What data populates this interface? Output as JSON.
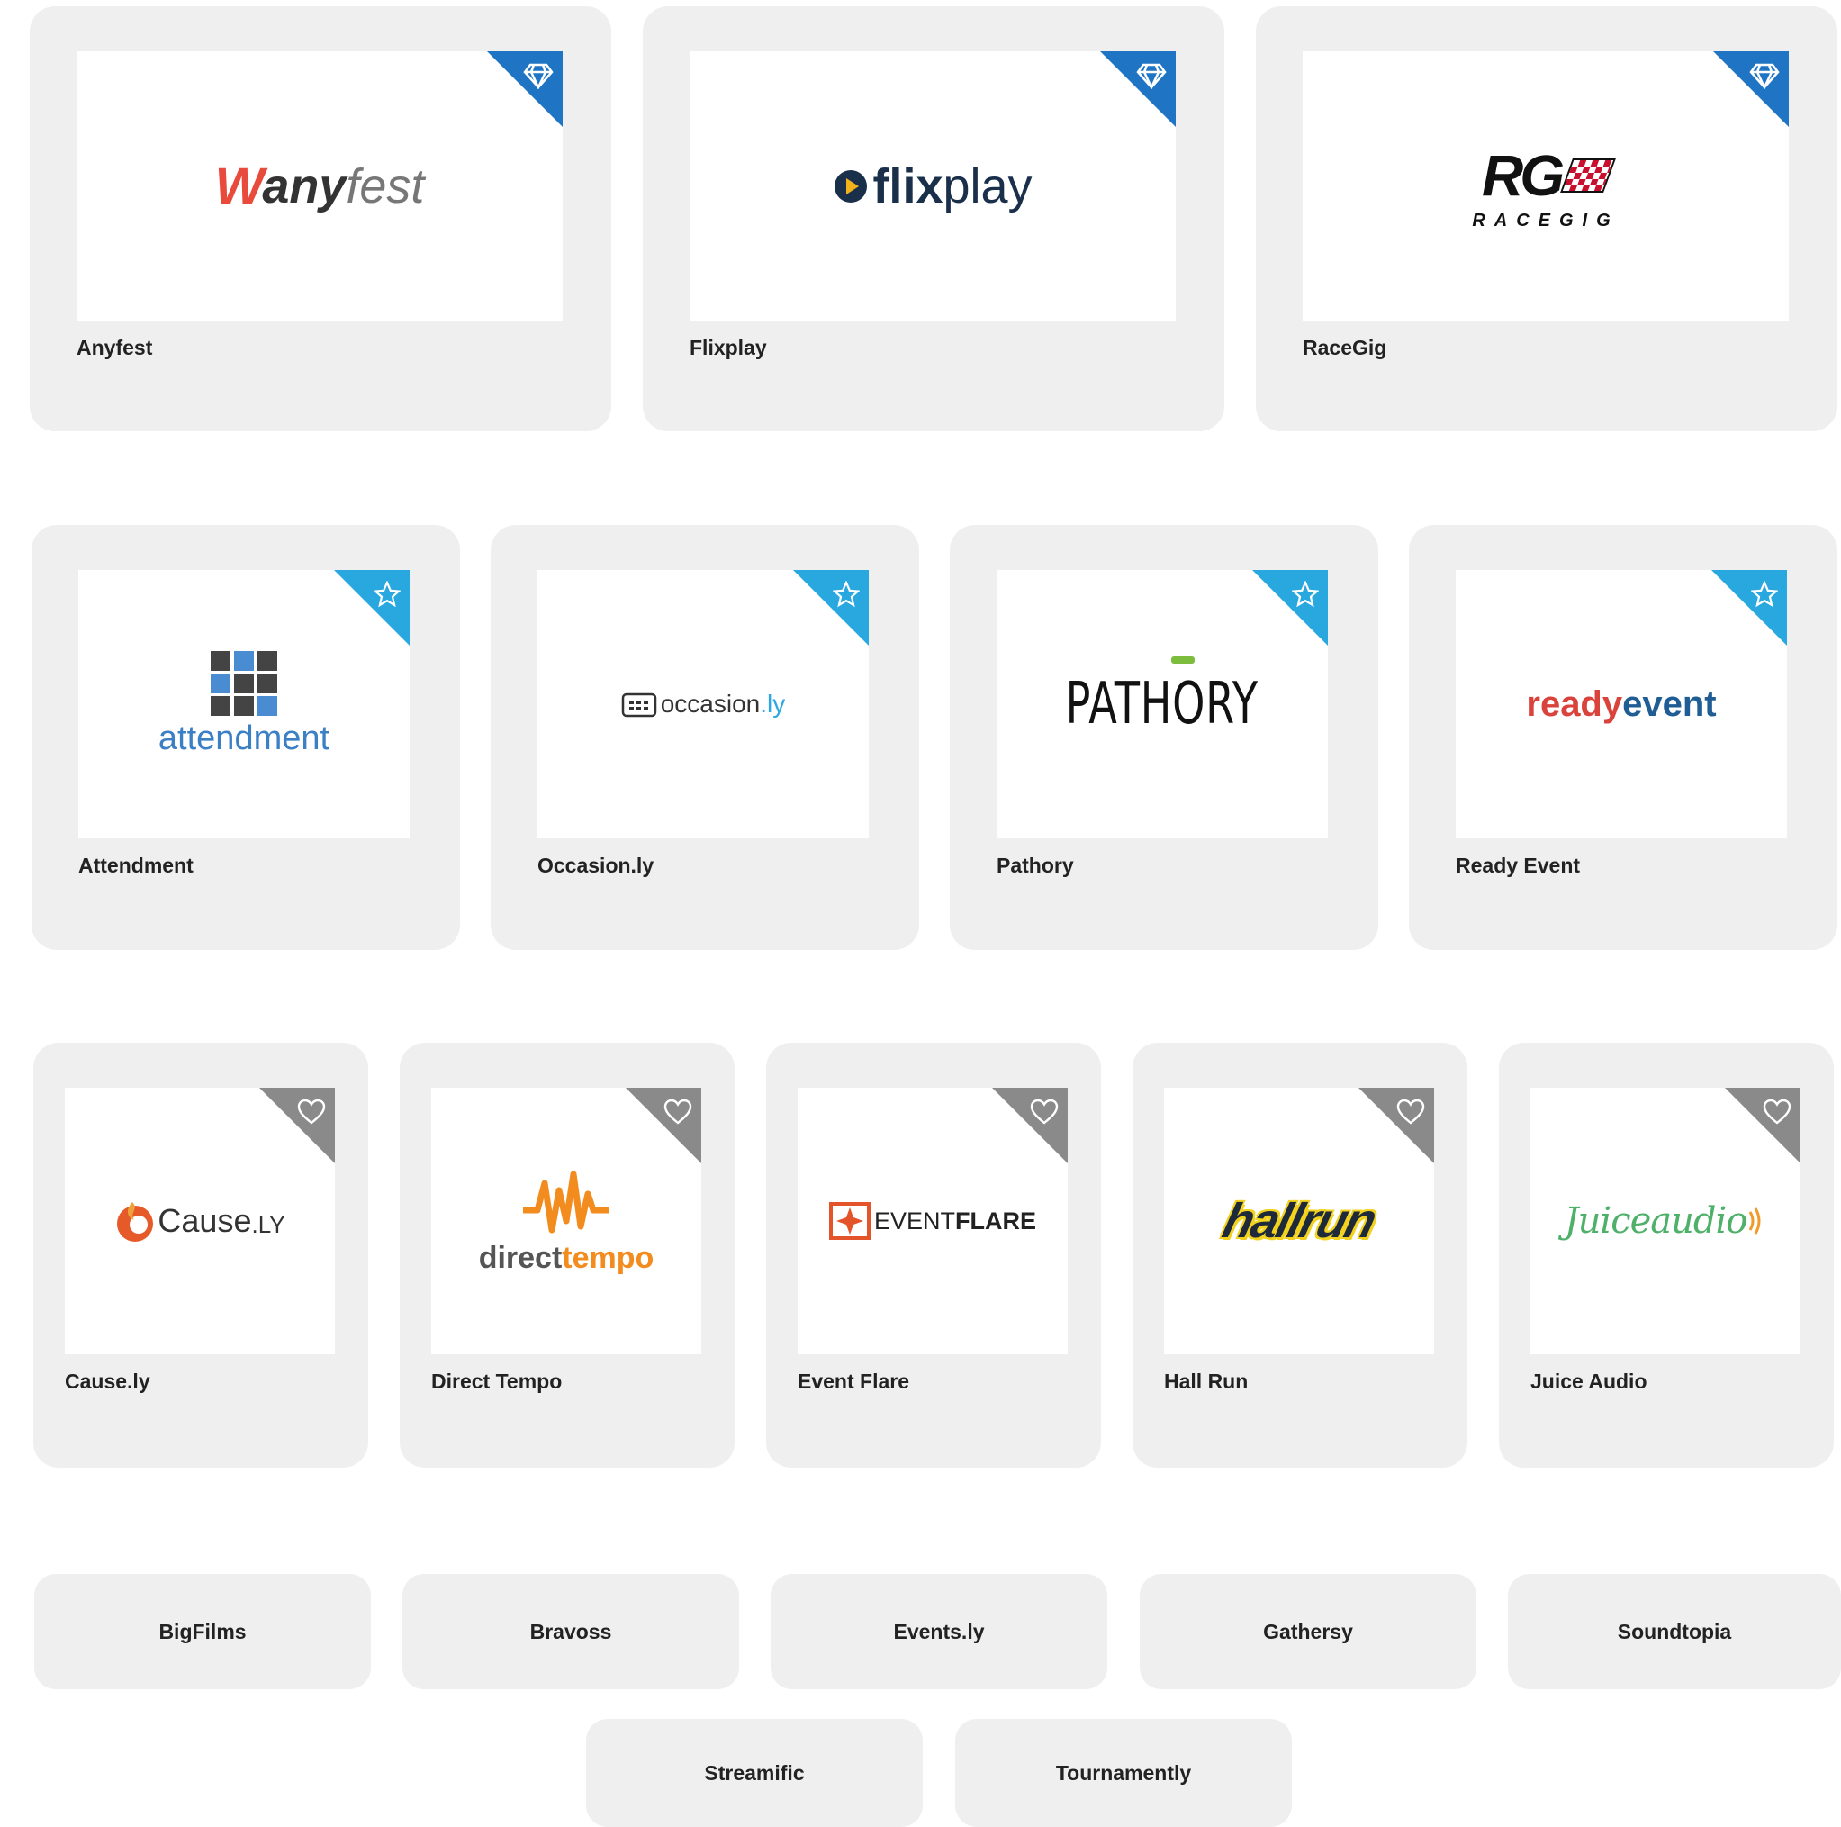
{
  "tier1": [
    {
      "name": "Anyfest",
      "logo": {
        "w": "W",
        "any": "any",
        "fest": "fest"
      }
    },
    {
      "name": "Flixplay",
      "logo": {
        "flix": "flix",
        "play": "play"
      }
    },
    {
      "name": "RaceGig",
      "logo": {
        "mark": "RG",
        "word": "RACEGIG"
      }
    }
  ],
  "tier2": [
    {
      "name": "Attendment",
      "logo": {
        "word": "attendment"
      }
    },
    {
      "name": "Occasion.ly",
      "logo": {
        "occasion": "occasion",
        "ly": ".ly"
      }
    },
    {
      "name": "Pathory",
      "logo": {
        "word": "PATHORY"
      }
    },
    {
      "name": "Ready Event",
      "logo": {
        "ready": "ready",
        "event": "event"
      }
    }
  ],
  "tier3": [
    {
      "name": "Cause.ly",
      "logo": {
        "cause": "Cause",
        "ly": ".LY"
      }
    },
    {
      "name": "Direct Tempo",
      "logo": {
        "direct": "direct",
        "tempo": "tempo"
      }
    },
    {
      "name": "Event Flare",
      "logo": {
        "event": "EVENT",
        "flare": "FLARE"
      }
    },
    {
      "name": "Hall Run",
      "logo": {
        "word": "hallrun"
      }
    },
    {
      "name": "Juice Audio",
      "logo": {
        "word": "Juiceaudio"
      }
    }
  ],
  "tier4": [
    "BigFilms",
    "Bravoss",
    "Events.ly",
    "Gathersy",
    "Soundtopia",
    "Streamific",
    "Tournamently"
  ],
  "icons": {
    "tier1": "diamond-icon",
    "tier2": "star-icon",
    "tier3": "heart-icon"
  },
  "colors": {
    "tier1_ribbon": "#1f75c4",
    "tier2_ribbon": "#29a8e0",
    "tier3_ribbon": "#8a8a8a",
    "card_bg": "#efefef"
  }
}
